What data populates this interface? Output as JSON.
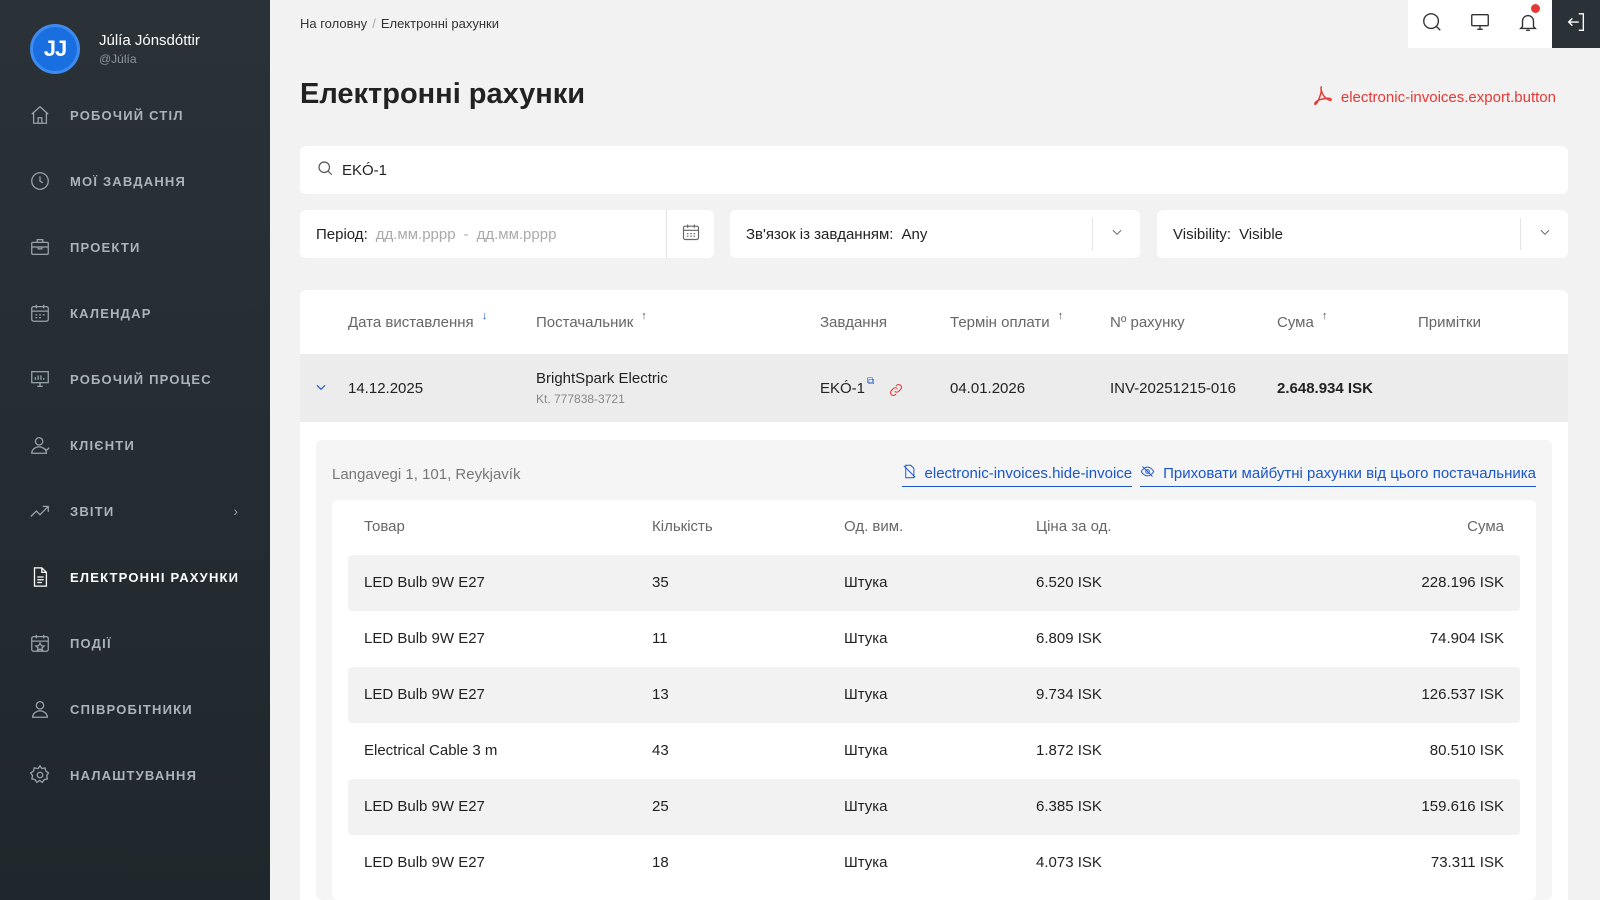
{
  "user": {
    "initials": "JJ",
    "name": "Júlía Jónsdóttir",
    "handle": "@Júlía"
  },
  "nav": [
    {
      "label": "РОБОЧИЙ СТІЛ",
      "icon": "home-icon"
    },
    {
      "label": "МОЇ ЗАВДАННЯ",
      "icon": "clock-icon"
    },
    {
      "label": "ПРОЕКТИ",
      "icon": "briefcase-icon"
    },
    {
      "label": "КАЛЕНДАР",
      "icon": "calendar-icon"
    },
    {
      "label": "РОБОЧИЙ ПРОЦЕС",
      "icon": "presentation-icon"
    },
    {
      "label": "КЛІЄНТИ",
      "icon": "user-icon"
    },
    {
      "label": "ЗВІТИ",
      "icon": "chart-line-icon"
    },
    {
      "label": "ЕЛЕКТРОННІ РАХУНКИ",
      "icon": "document-icon"
    },
    {
      "label": "ПОДІЇ",
      "icon": "calendar-star-icon"
    },
    {
      "label": "СПІВРОБІТНИКИ",
      "icon": "users-icon"
    },
    {
      "label": "НАЛАШТУВАННЯ",
      "icon": "gear-icon"
    }
  ],
  "breadcrumb": {
    "home": "На головну",
    "sep": "/",
    "current": "Електронні рахунки"
  },
  "page": {
    "title": "Електронні рахунки",
    "export_label": "electronic-invoices.export.button"
  },
  "search": {
    "value": "EKÓ-1"
  },
  "filters": {
    "period_label": "Період:",
    "period_from": "дд.мм.рррр",
    "period_dash": "-",
    "period_to": "дд.мм.рррр",
    "task_label": "Зв'язок із завданням:",
    "task_value": "Any",
    "visibility_label": "Visibility:",
    "visibility_value": "Visible"
  },
  "table": {
    "headers": {
      "date": "Дата виставлення",
      "supplier": "Постачальник",
      "task": "Завдання",
      "due": "Термін оплати",
      "number": "Nº рахунку",
      "sum": "Сума",
      "notes": "Примітки"
    },
    "sort_arrows": {
      "date": "↓",
      "supplier": "↑",
      "due": "↑",
      "sum": "↑"
    },
    "row": {
      "date": "14.12.2025",
      "supplier": "BrightSpark Electric",
      "kt": "Kt. 777838-3721",
      "task": "EKÓ-1",
      "external_mark": "⧉",
      "due": "04.01.2026",
      "number": "INV-20251215-016",
      "sum": "2.648.934 ISK"
    }
  },
  "detail": {
    "address": "Langavegi 1, 101, Reykjavík",
    "hide_invoice": "electronic-invoices.hide-invoice",
    "hide_future": "Приховати майбутні рахунки від цього постачальника",
    "headers": {
      "product": "Товар",
      "qty": "Кількість",
      "unit": "Од. вим.",
      "price": "Ціна за од.",
      "sum": "Сума"
    },
    "items": [
      {
        "product": "LED Bulb 9W E27",
        "qty": "35",
        "unit": "Штука",
        "price": "6.520 ISK",
        "sum": "228.196 ISK"
      },
      {
        "product": "LED Bulb 9W E27",
        "qty": "11",
        "unit": "Штука",
        "price": "6.809 ISK",
        "sum": "74.904 ISK"
      },
      {
        "product": "LED Bulb 9W E27",
        "qty": "13",
        "unit": "Штука",
        "price": "9.734 ISK",
        "sum": "126.537 ISK"
      },
      {
        "product": "Electrical Cable 3 m",
        "qty": "43",
        "unit": "Штука",
        "price": "1.872 ISK",
        "sum": "80.510 ISK"
      },
      {
        "product": "LED Bulb 9W E27",
        "qty": "25",
        "unit": "Штука",
        "price": "6.385 ISK",
        "sum": "159.616 ISK"
      },
      {
        "product": "LED Bulb 9W E27",
        "qty": "18",
        "unit": "Штука",
        "price": "4.073 ISK",
        "sum": "73.311 ISK"
      }
    ]
  },
  "colors": {
    "accent": "#1a56c8",
    "danger": "#e53935",
    "sidebar": "#2a3238"
  }
}
